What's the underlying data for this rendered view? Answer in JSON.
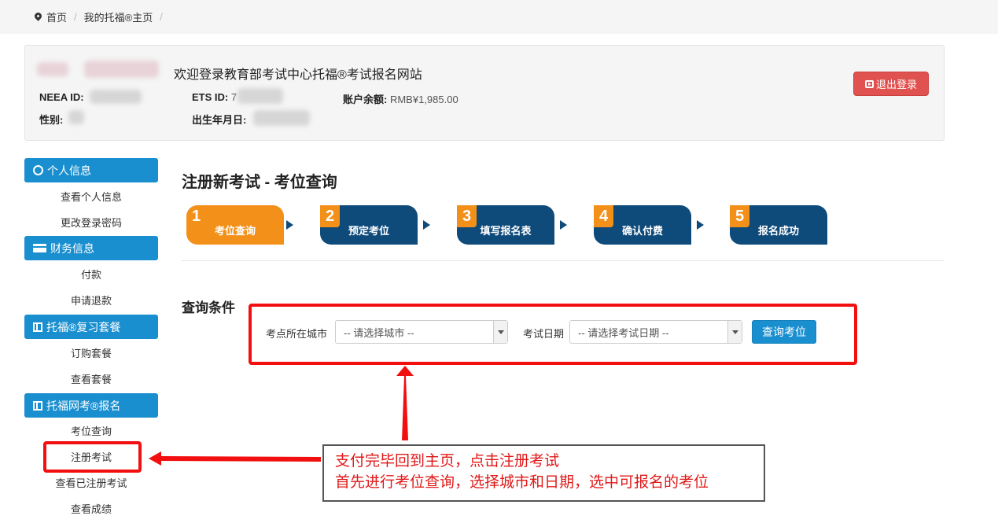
{
  "breadcrumb": {
    "home": "首页",
    "current": "我的托福®主页"
  },
  "user": {
    "welcome": "欢迎登录教育部考试中心托福®考试报名网站",
    "neea_label": "NEEA ID:",
    "ets_label": "ETS ID:",
    "ets_value_visible": "7",
    "balance_label": "账户余额:",
    "balance_value": "RMB¥1,985.00",
    "gender_label": "性别:",
    "birth_label": "出生年月日:",
    "logout": "退出登录"
  },
  "sidebar": {
    "sections": [
      {
        "title": "个人信息",
        "icon": "user-circle-icon",
        "items": [
          "查看个人信息",
          "更改登录密码"
        ]
      },
      {
        "title": "财务信息",
        "icon": "credit-card-icon",
        "items": [
          "付款",
          "申请退款"
        ]
      },
      {
        "title": "托福®复习套餐",
        "icon": "book-icon",
        "items": [
          "订购套餐",
          "查看套餐"
        ]
      },
      {
        "title": "托福网考®报名",
        "icon": "book-icon",
        "items": [
          "考位查询",
          "注册考试",
          "查看已注册考试",
          "查看成绩"
        ]
      }
    ]
  },
  "main": {
    "title": "注册新考试 - 考位查询",
    "steps": [
      {
        "num": "1",
        "label": "考位查询",
        "active": true
      },
      {
        "num": "2",
        "label": "预定考位",
        "active": false
      },
      {
        "num": "3",
        "label": "填写报名表",
        "active": false
      },
      {
        "num": "4",
        "label": "确认付费",
        "active": false
      },
      {
        "num": "5",
        "label": "报名成功",
        "active": false
      }
    ],
    "query_title": "查询条件",
    "city_label": "考点所在城市",
    "city_value": "-- 请选择城市 --",
    "date_label": "考试日期",
    "date_value": "-- 请选择考试日期 --",
    "query_button": "查询考位"
  },
  "annotation": {
    "line1": "支付完毕回到主页，点击注册考试",
    "line2": "首先进行考位查询，选择城市和日期，选中可报名的考位"
  },
  "colors": {
    "primary": "#1a8fcf",
    "step_dark": "#0e4a7a",
    "step_active": "#f39019",
    "danger": "#e0524f",
    "annotation_red": "#f20f0f"
  }
}
